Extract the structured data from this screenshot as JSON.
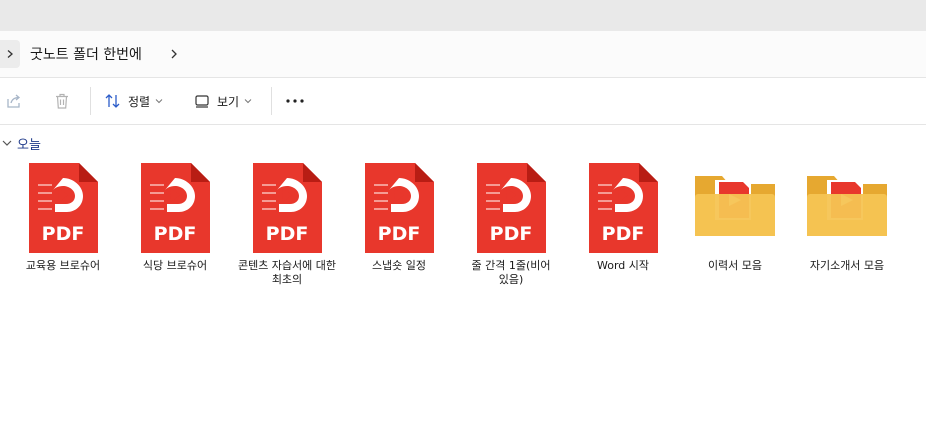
{
  "address": {
    "path_label": "굿노트 폴더 한번에"
  },
  "toolbar": {
    "share_icon": "share-icon",
    "delete_icon": "trash-icon",
    "sort_label": "정렬",
    "view_label": "보기",
    "more_icon": "more-icon"
  },
  "group": {
    "label": "오늘"
  },
  "files": [
    {
      "name": "교육용 브로슈어",
      "type": "pdf"
    },
    {
      "name": "식당 브로슈어",
      "type": "pdf"
    },
    {
      "name": "콘텐츠 자습서에 대한 최초의",
      "type": "pdf"
    },
    {
      "name": "스냅숏 일정",
      "type": "pdf"
    },
    {
      "name": "줄 간격 1줄(비어 있음)",
      "type": "pdf"
    },
    {
      "name": "Word 시작",
      "type": "pdf"
    },
    {
      "name": "이력서 모음",
      "type": "folder"
    },
    {
      "name": "자기소개서 모음",
      "type": "folder"
    }
  ],
  "icons": {
    "pdf_badge_text": "PDF"
  },
  "colors": {
    "pdf_red": "#e8372c",
    "pdf_red_dark": "#b81d14",
    "folder_yellow": "#f6c453",
    "folder_back": "#e6a830",
    "accent_blue": "#1f3a8a"
  }
}
